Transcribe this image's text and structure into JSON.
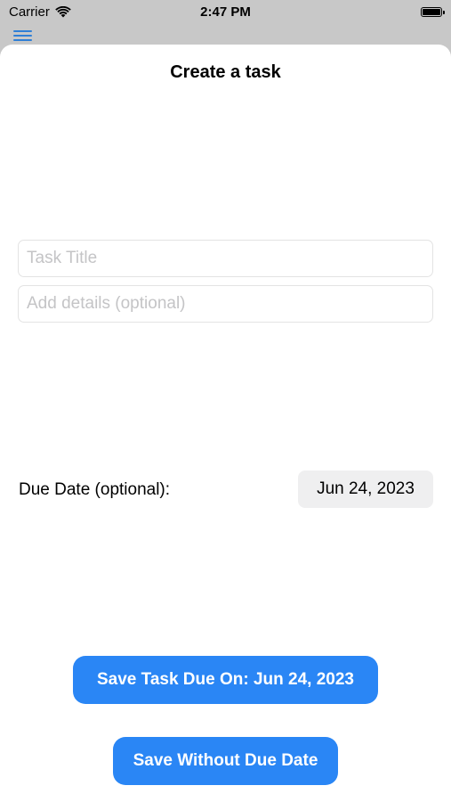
{
  "status_bar": {
    "carrier": "Carrier",
    "time": "2:47 PM",
    "wifi_icon": "wifi-icon",
    "battery_icon": "battery-icon",
    "battery_level": 1.0
  },
  "nav": {
    "menu_icon": "hamburger-menu-icon",
    "menu_color": "#2f7fd6"
  },
  "sheet": {
    "title": "Create a task",
    "task_title": {
      "value": "",
      "placeholder": "Task Title"
    },
    "details": {
      "value": "",
      "placeholder": "Add details (optional)"
    },
    "due_date_label": "Due Date (optional):",
    "due_date_value": "Jun 24, 2023",
    "save_due_button": "Save Task Due On: Jun 24, 2023",
    "save_no_due_button": "Save Without Due Date",
    "accent_color": "#2a86f5"
  }
}
